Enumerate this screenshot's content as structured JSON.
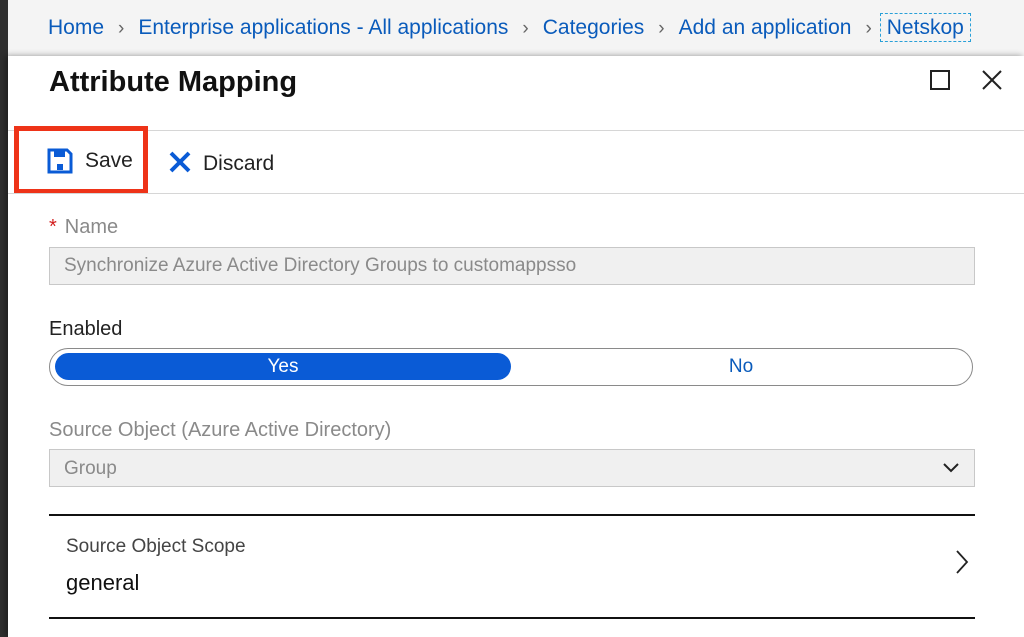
{
  "breadcrumb": {
    "items": [
      "Home",
      "Enterprise applications - All applications",
      "Categories",
      "Add an application"
    ],
    "current": "Netskop"
  },
  "blade": {
    "title": "Attribute Mapping"
  },
  "toolbar": {
    "save_label": "Save",
    "discard_label": "Discard"
  },
  "form": {
    "name_label": "Name",
    "required_marker": "*",
    "name_value": "Synchronize Azure Active Directory Groups to customappsso",
    "enabled_label": "Enabled",
    "enabled_yes": "Yes",
    "enabled_no": "No",
    "enabled_selected": "Yes",
    "source_object_label": "Source Object (Azure Active Directory)",
    "source_object_value": "Group",
    "scope_label": "Source Object Scope",
    "scope_value": "general"
  },
  "colors": {
    "link": "#0a5bbb",
    "toggle_active": "#0a5bd6",
    "highlight_box": "#ee3318",
    "required": "#d21c1c"
  },
  "icons": [
    "chevron-right-icon",
    "maximize-icon",
    "close-icon",
    "floppy-disk-icon",
    "discard-x-icon",
    "chevron-down-icon"
  ]
}
